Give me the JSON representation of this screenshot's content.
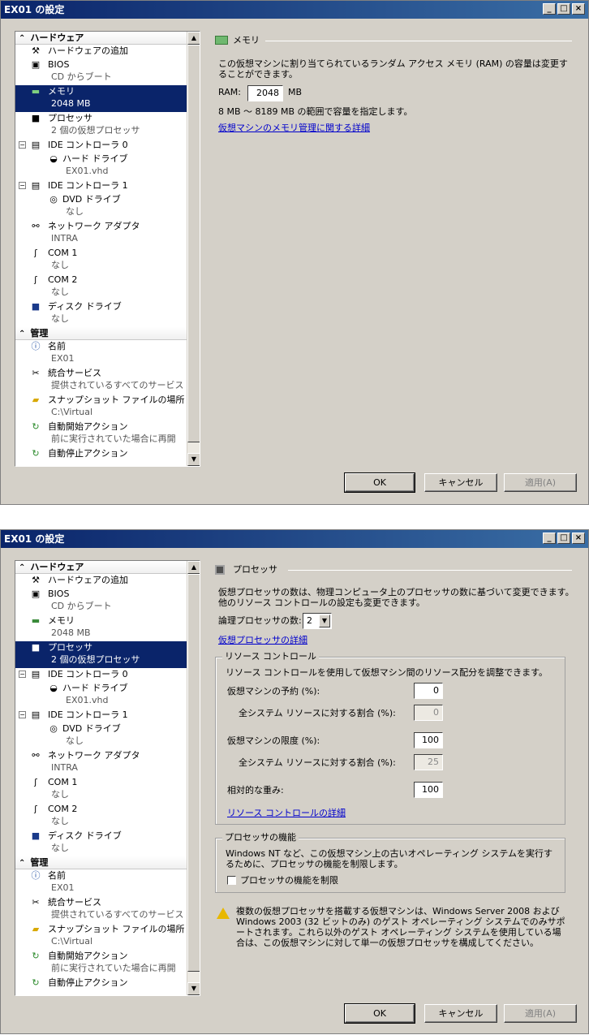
{
  "window1": {
    "title": "EX01 の設定",
    "tree": {
      "hardware_label": "ハードウェア",
      "add_hardware": "ハードウェアの追加",
      "bios": "BIOS",
      "bios_sub": "CD からブート",
      "memory": "メモリ",
      "memory_sub": "2048 MB",
      "processor": "プロセッサ",
      "processor_sub": "2 個の仮想プロセッサ",
      "ide0": "IDE コントローラ 0",
      "hdd": "ハード ドライブ",
      "hdd_sub": "EX01.vhd",
      "ide1": "IDE コントローラ 1",
      "dvd": "DVD ドライブ",
      "dvd_sub": "なし",
      "nic": "ネットワーク アダプタ",
      "nic_sub": "INTRA",
      "com1": "COM 1",
      "com1_sub": "なし",
      "com2": "COM 2",
      "com2_sub": "なし",
      "disk": "ディスク ドライブ",
      "disk_sub": "なし",
      "mgmt_label": "管理",
      "name": "名前",
      "name_sub": "EX01",
      "integration": "統合サービス",
      "integration_sub": "提供されているすべてのサービス",
      "snapshot": "スナップショット ファイルの場所",
      "snapshot_sub": "C:\\Virtual",
      "autostart": "自動開始アクション",
      "autostart_sub": "前に実行されていた場合に再開",
      "autostop": "自動停止アクション"
    },
    "panel": {
      "header": "メモリ",
      "desc": "この仮想マシンに割り当てられているランダム アクセス メモリ (RAM) の容量は変更することができます。",
      "ram_label": "RAM:",
      "ram_value": "2048",
      "ram_unit": "MB",
      "range": "8 MB ～ 8189 MB の範囲で容量を指定します。",
      "link": "仮想マシンのメモリ管理に関する詳細"
    },
    "buttons": {
      "ok": "OK",
      "cancel": "キャンセル",
      "apply": "適用(A)"
    }
  },
  "window2": {
    "title": "EX01 の設定",
    "panel": {
      "header": "プロセッサ",
      "desc": "仮想プロセッサの数は、物理コンピュータ上のプロセッサの数に基づいて変更できます。他のリソース コントロールの設定も変更できます。",
      "count_label": "論理プロセッサの数:",
      "count_value": "2",
      "link1": "仮想プロセッサの詳細",
      "rc_title": "リソース コントロール",
      "rc_desc": "リソース コントロールを使用して仮想マシン間のリソース配分を調整できます。",
      "reserve_label": "仮想マシンの予約 (%):",
      "reserve_value": "0",
      "reserve_pct_label": "全システム リソースに対する割合 (%):",
      "reserve_pct_value": "0",
      "limit_label": "仮想マシンの限度 (%):",
      "limit_value": "100",
      "limit_pct_label": "全システム リソースに対する割合 (%):",
      "limit_pct_value": "25",
      "weight_label": "相対的な重み:",
      "weight_value": "100",
      "link2": "リソース コントロールの詳細",
      "func_title": "プロセッサの機能",
      "func_desc": "Windows NT など、この仮想マシン上の古いオペレーティング システムを実行するために、プロセッサの機能を制限します。",
      "func_check": "プロセッサの機能を制限",
      "warning": "複数の仮想プロセッサを搭載する仮想マシンは、Windows Server 2008 および Windows 2003 (32 ビットのみ) のゲスト オペレーティング システムでのみサポートされます。これら以外のゲスト オペレーティング システムを使用している場合は、この仮想マシンに対して単一の仮想プロセッサを構成してください。"
    },
    "buttons": {
      "ok": "OK",
      "cancel": "キャンセル",
      "apply": "適用(A)"
    }
  },
  "colors": {
    "titlebar": "#0a246a",
    "selection": "#0a246a",
    "link": "#0000cc",
    "face": "#d4d0c8"
  }
}
